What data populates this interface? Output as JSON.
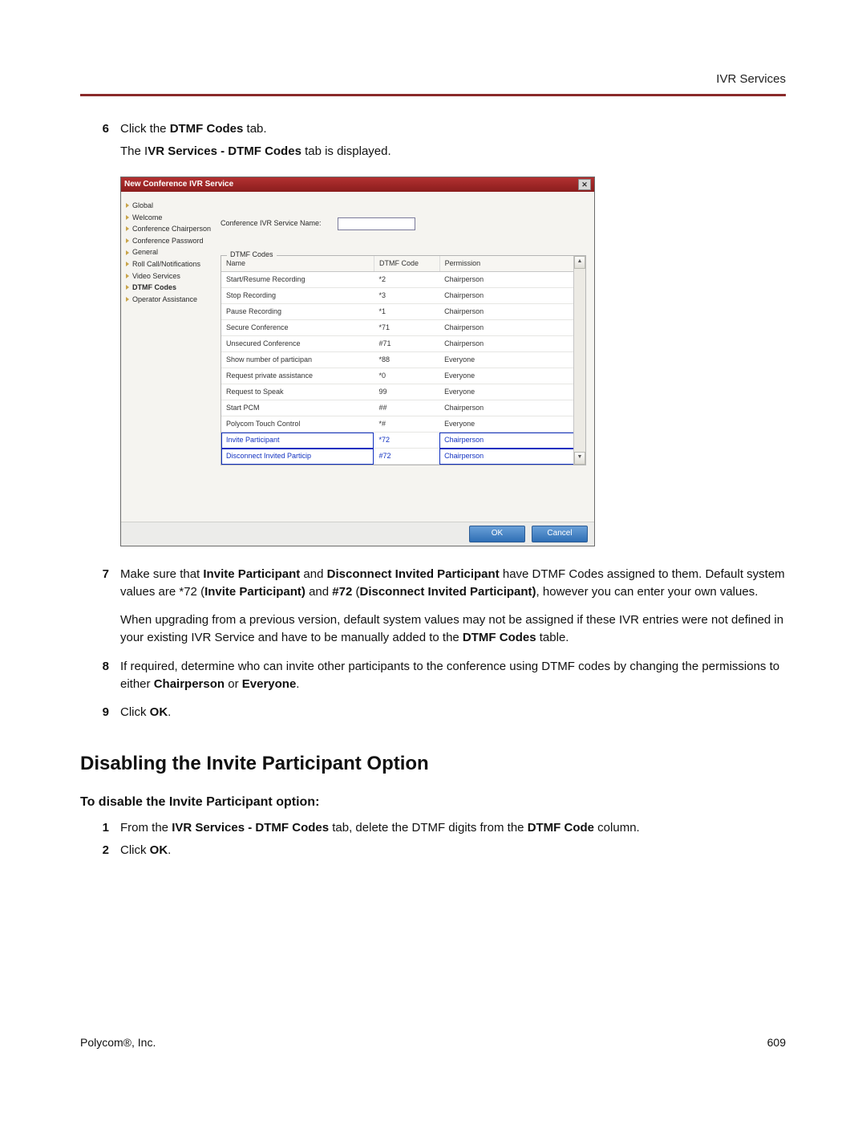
{
  "header": {
    "section": "IVR Services"
  },
  "steps_a": {
    "s6": {
      "num": "6",
      "prefix": "Click the ",
      "bold": "DTMF Codes",
      "suffix": " tab."
    },
    "s6b_prefix": "The I",
    "s6b_bold": "VR Services - DTMF Codes",
    "s6b_suffix": " tab is displayed."
  },
  "dialog": {
    "title": "New Conference IVR Service",
    "sidebar": {
      "items": [
        {
          "label": "Global"
        },
        {
          "label": "Welcome"
        },
        {
          "label": "Conference Chairperson"
        },
        {
          "label": "Conference Password"
        },
        {
          "label": "General"
        },
        {
          "label": "Roll Call/Notifications"
        },
        {
          "label": "Video Services"
        },
        {
          "label": "DTMF Codes",
          "selected": true
        },
        {
          "label": "Operator Assistance"
        }
      ]
    },
    "field_label": "Conference IVR Service Name:",
    "group_label": "DTMF Codes",
    "table": {
      "headers": {
        "name": "Name",
        "code": "DTMF Code",
        "perm": "Permission"
      },
      "rows": [
        {
          "name": "Start/Resume Recording",
          "code": "*2",
          "perm": "Chairperson"
        },
        {
          "name": "Stop Recording",
          "code": "*3",
          "perm": "Chairperson"
        },
        {
          "name": "Pause Recording",
          "code": "*1",
          "perm": "Chairperson"
        },
        {
          "name": "Secure Conference",
          "code": "*71",
          "perm": "Chairperson"
        },
        {
          "name": "Unsecured Conference",
          "code": "#71",
          "perm": "Chairperson"
        },
        {
          "name": "Show number of participan",
          "code": "*88",
          "perm": "Everyone"
        },
        {
          "name": "Request private assistance",
          "code": "*0",
          "perm": "Everyone"
        },
        {
          "name": "Request to Speak",
          "code": "99",
          "perm": "Everyone"
        },
        {
          "name": "Start PCM",
          "code": "##",
          "perm": "Chairperson"
        },
        {
          "name": "Polycom Touch Control",
          "code": "*#",
          "perm": "Everyone"
        },
        {
          "name": "Invite Participant",
          "code": "*72",
          "perm": "Chairperson",
          "hl": true
        },
        {
          "name": "Disconnect Invited Particip",
          "code": "#72",
          "perm": "Chairperson",
          "hl": true
        }
      ]
    },
    "buttons": {
      "ok": "OK",
      "cancel": "Cancel"
    }
  },
  "steps_b": {
    "s7": {
      "num": "7",
      "t1": "Make sure that ",
      "b1": "Invite Participant",
      "t2": " and ",
      "b2": "Disconnect Invited Participant",
      "t3": " have DTMF Codes assigned to them. Default system values are *72 (",
      "b3": "Invite Participant)",
      "t4": " and ",
      "b4": "#72",
      "t5": " (",
      "b5": "Disconnect Invited Participant)",
      "t6": ", however you can enter your own values."
    },
    "s7b": {
      "t1": "When upgrading from a previous version, default system values may not be assigned if these IVR entries were not defined in your existing IVR Service and have to be manually added to the ",
      "b1": "DTMF Codes",
      "t2": " table."
    },
    "s8": {
      "num": "8",
      "t1": "If required, determine who can invite other participants to the conference using DTMF codes by changing the permissions to either ",
      "b1": "Chairperson",
      "t2": " or ",
      "b2": "Everyone",
      "t3": "."
    },
    "s9": {
      "num": "9",
      "t1": "Click ",
      "b1": "OK",
      "t2": "."
    }
  },
  "section2": {
    "heading": "Disabling the Invite Participant Option",
    "sub": "To disable the Invite Participant option:",
    "s1": {
      "num": "1",
      "t1": "From the ",
      "b1": "IVR Services - DTMF Codes",
      "t2": " tab, delete the DTMF digits from the ",
      "b2": "DTMF Code",
      "t3": " column."
    },
    "s2": {
      "num": "2",
      "t1": "Click ",
      "b1": "OK",
      "t2": "."
    }
  },
  "footer": {
    "left": "Polycom®, Inc.",
    "right": "609"
  }
}
